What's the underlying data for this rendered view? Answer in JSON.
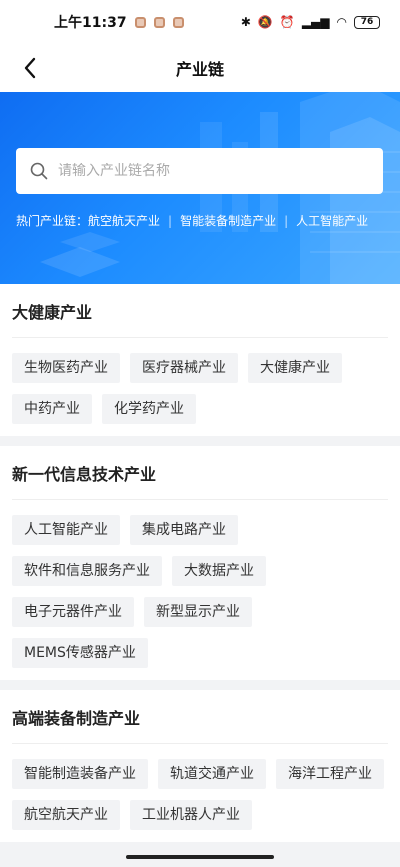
{
  "status_bar": {
    "time": "上午11:37",
    "battery": "76"
  },
  "nav": {
    "title": "产业链"
  },
  "search": {
    "placeholder": "请输入产业链名称"
  },
  "hot": {
    "label": "热门产业链：",
    "items": [
      "航空航天产业",
      "智能装备制造产业",
      "人工智能产业"
    ]
  },
  "sections": [
    {
      "title": "大健康产业",
      "tags": [
        "生物医药产业",
        "医疗器械产业",
        "大健康产业",
        "中药产业",
        "化学药产业"
      ]
    },
    {
      "title": "新一代信息技术产业",
      "tags": [
        "人工智能产业",
        "集成电路产业",
        "软件和信息服务产业",
        "大数据产业",
        "电子元器件产业",
        "新型显示产业",
        "MEMS传感器产业"
      ]
    },
    {
      "title": "高端装备制造产业",
      "tags": [
        "智能制造装备产业",
        "轨道交通产业",
        "海洋工程产业",
        "航空航天产业",
        "工业机器人产业"
      ]
    }
  ],
  "colors": {
    "banner": "#1d8cff",
    "tag_bg": "#f2f3f5"
  }
}
